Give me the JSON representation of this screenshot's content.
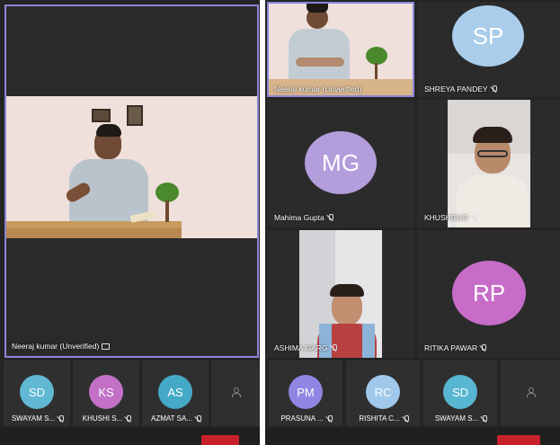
{
  "left": {
    "main_speaker": {
      "name": "Neeraj kumar (Unverified)"
    },
    "strip": [
      {
        "initials": "SD",
        "name": "SWAYAM S...",
        "color": "#60b8d3"
      },
      {
        "initials": "KS",
        "name": "KHUSHI S...",
        "color": "#c271c7"
      },
      {
        "initials": "AS",
        "name": "AZMAT SA...",
        "color": "#44a9c6"
      }
    ]
  },
  "right": {
    "tiles": [
      {
        "name": "Neeraj kumar (Unverified)"
      },
      {
        "initials": "SP",
        "name": "SHREYA PANDEY",
        "color": "#a9cdea"
      },
      {
        "initials": "MG",
        "name": "Mahima  Gupta",
        "color": "#b39ddb"
      },
      {
        "name": "KHUSHBOO"
      },
      {
        "name": "ASHIMA GARG"
      },
      {
        "initials": "RP",
        "name": "RITIKA PAWAR",
        "color": "#c76cc9"
      }
    ],
    "strip": [
      {
        "initials": "PM",
        "name": "PRASUNA ...",
        "color": "#8f86e3"
      },
      {
        "initials": "RC",
        "name": "RISHITA C...",
        "color": "#9fc8ea"
      },
      {
        "initials": "SD",
        "name": "SWAYAM S...",
        "color": "#57b6d0"
      }
    ]
  },
  "colors": {
    "active_border": "#8b86d8",
    "leave": "#c8202b"
  }
}
